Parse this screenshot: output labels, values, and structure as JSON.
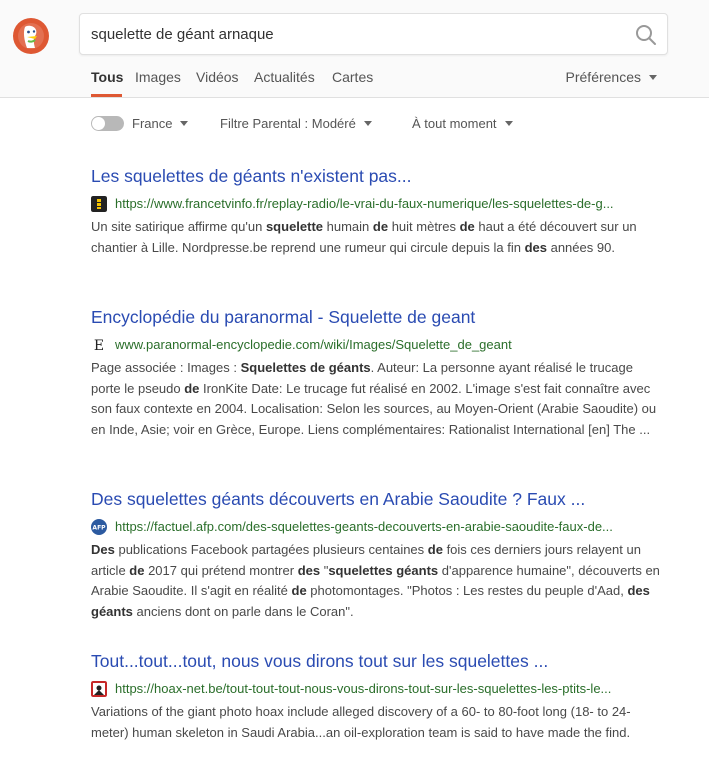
{
  "search": {
    "query": "squelette de géant arnaque"
  },
  "tabs": [
    {
      "label": "Tous",
      "active": true
    },
    {
      "label": "Images"
    },
    {
      "label": "Vidéos"
    },
    {
      "label": "Actualités"
    },
    {
      "label": "Cartes"
    }
  ],
  "preferences": "Préférences",
  "filters": {
    "region": "France",
    "safe_search": "Filtre Parental : Modéré",
    "time": "À tout moment"
  },
  "results": [
    {
      "title": "Les squelettes de géants n'existent pas...",
      "url": "https://www.francetvinfo.fr/replay-radio/le-vrai-du-faux-numerique/les-squelettes-de-g...",
      "favicon": "francetvinfo-icon",
      "snippet": [
        {
          "t": "Un site satirique affirme qu'un "
        },
        {
          "t": "squelette",
          "b": true
        },
        {
          "t": " humain "
        },
        {
          "t": "de",
          "b": true
        },
        {
          "t": " huit mètres "
        },
        {
          "t": "de",
          "b": true
        },
        {
          "t": " haut a été découvert sur un chantier à Lille. Nordpresse.be reprend une rumeur qui circule depuis la fin "
        },
        {
          "t": "des",
          "b": true
        },
        {
          "t": " années 90."
        }
      ]
    },
    {
      "title": "Encyclopédie du paranormal - Squelette de geant",
      "url": "www.paranormal-encyclopedie.com/wiki/Images/Squelette_de_geant",
      "favicon": "encyclopedie-icon",
      "snippet": [
        {
          "t": "Page associée : Images : "
        },
        {
          "t": "Squelettes de géants",
          "b": true
        },
        {
          "t": ". Auteur: La personne ayant réalisé le trucage porte le pseudo "
        },
        {
          "t": "de",
          "b": true
        },
        {
          "t": " IronKite Date: Le trucage fut réalisé en 2002. L'image s'est fait connaître avec son faux contexte en 2004. Localisation: Selon les sources, au Moyen-Orient (Arabie Saoudite) ou en Inde, Asie; voir en Grèce, Europe. Liens complémentaires: Rationalist International [en] The ..."
        }
      ]
    },
    {
      "title": "Des squelettes géants découverts en Arabie Saoudite ? Faux ...",
      "url": "https://factuel.afp.com/des-squelettes-geants-decouverts-en-arabie-saoudite-faux-de...",
      "favicon": "afp-icon",
      "snippet": [
        {
          "t": "Des",
          "b": true
        },
        {
          "t": " publications Facebook partagées plusieurs centaines "
        },
        {
          "t": "de",
          "b": true
        },
        {
          "t": " fois ces derniers jours relayent un article "
        },
        {
          "t": "de",
          "b": true
        },
        {
          "t": " 2017 qui prétend montrer "
        },
        {
          "t": "des",
          "b": true
        },
        {
          "t": " \""
        },
        {
          "t": "squelettes géants",
          "b": true
        },
        {
          "t": " d'apparence humaine\", découverts en Arabie Saoudite. Il s'agit en réalité "
        },
        {
          "t": "de",
          "b": true
        },
        {
          "t": " photomontages. \"Photos : Les restes du peuple d'Aad, "
        },
        {
          "t": "des géants",
          "b": true
        },
        {
          "t": " anciens dont on parle dans le Coran\"."
        }
      ]
    },
    {
      "title": "Tout...tout...tout, nous vous dirons tout sur les squelettes ...",
      "url": "https://hoax-net.be/tout-tout-tout-nous-vous-dirons-tout-sur-les-squelettes-les-ptits-le...",
      "favicon": "hoaxnet-icon",
      "snippet": [
        {
          "t": "Variations of the giant photo hoax include alleged discovery of a 60- to 80-foot long (18- to 24-meter) human skeleton in Saudi Arabia...an oil-exploration team is said to have made the find."
        }
      ]
    }
  ]
}
